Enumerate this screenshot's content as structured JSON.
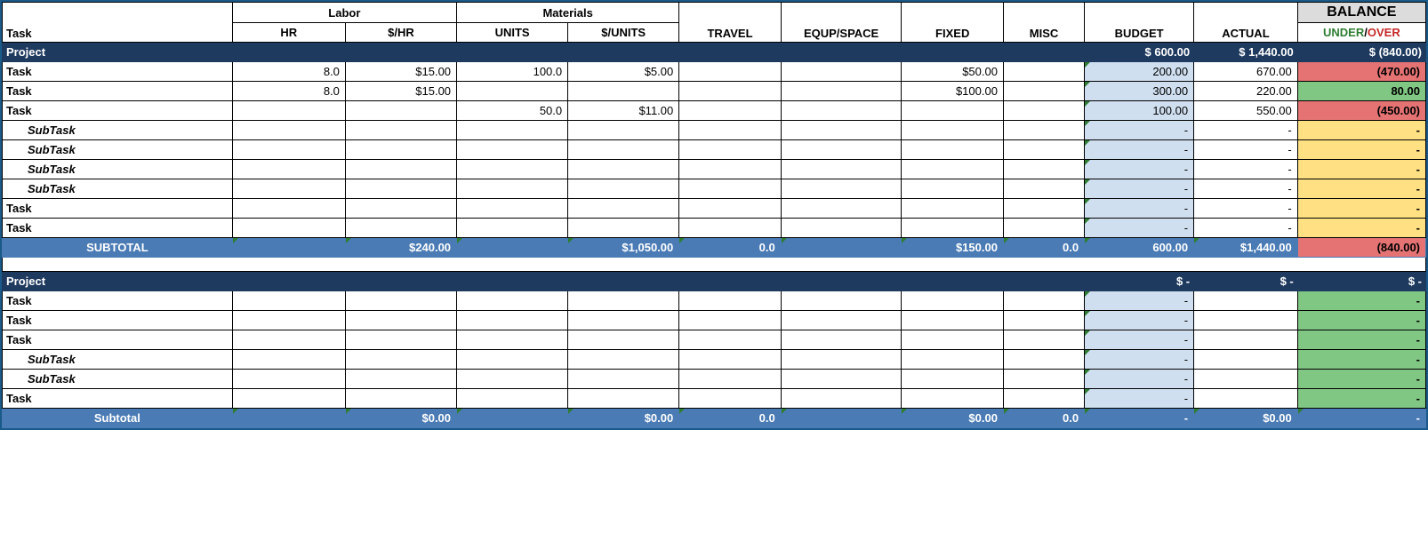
{
  "headers": {
    "labor": "Labor",
    "materials": "Materials",
    "balance": "BALANCE",
    "task": "Task",
    "hr": "HR",
    "rate": "$/HR",
    "units": "UNITS",
    "urate": "$/UNITS",
    "travel": "TRAVEL",
    "equip": "EQUP/SPACE",
    "fixed": "FIXED",
    "misc": "MISC",
    "budget": "BUDGET",
    "actual": "ACTUAL",
    "under": "UNDER",
    "slash": "/",
    "over": "OVER"
  },
  "p1": {
    "label": "Project",
    "budget": "$    600.00",
    "actual": "$ 1,440.00",
    "balance": "$      (840.00)",
    "rows": [
      {
        "label": "Task",
        "type": "task",
        "hr": "8.0",
        "rate": "$15.00",
        "units": "100.0",
        "urate": "$5.00",
        "travel": "",
        "equip": "",
        "fixed": "$50.00",
        "misc": "",
        "budget": "200.00",
        "actual": "670.00",
        "balance": "(470.00)",
        "balclass": "bal-red"
      },
      {
        "label": "Task",
        "type": "task",
        "hr": "8.0",
        "rate": "$15.00",
        "units": "",
        "urate": "",
        "travel": "",
        "equip": "",
        "fixed": "$100.00",
        "misc": "",
        "budget": "300.00",
        "actual": "220.00",
        "balance": "80.00",
        "balclass": "bal-green"
      },
      {
        "label": "Task",
        "type": "task",
        "hr": "",
        "rate": "",
        "units": "50.0",
        "urate": "$11.00",
        "travel": "",
        "equip": "",
        "fixed": "",
        "misc": "",
        "budget": "100.00",
        "actual": "550.00",
        "balance": "(450.00)",
        "balclass": "bal-red"
      },
      {
        "label": "SubTask",
        "type": "sub",
        "hr": "",
        "rate": "",
        "units": "",
        "urate": "",
        "travel": "",
        "equip": "",
        "fixed": "",
        "misc": "",
        "budget": "-",
        "actual": "-",
        "balance": "-",
        "balclass": "bal-yellow"
      },
      {
        "label": "SubTask",
        "type": "sub",
        "hr": "",
        "rate": "",
        "units": "",
        "urate": "",
        "travel": "",
        "equip": "",
        "fixed": "",
        "misc": "",
        "budget": "-",
        "actual": "-",
        "balance": "-",
        "balclass": "bal-yellow"
      },
      {
        "label": "SubTask",
        "type": "sub",
        "hr": "",
        "rate": "",
        "units": "",
        "urate": "",
        "travel": "",
        "equip": "",
        "fixed": "",
        "misc": "",
        "budget": "-",
        "actual": "-",
        "balance": "-",
        "balclass": "bal-yellow"
      },
      {
        "label": "SubTask",
        "type": "sub",
        "hr": "",
        "rate": "",
        "units": "",
        "urate": "",
        "travel": "",
        "equip": "",
        "fixed": "",
        "misc": "",
        "budget": "-",
        "actual": "-",
        "balance": "-",
        "balclass": "bal-yellow"
      },
      {
        "label": "Task",
        "type": "task",
        "hr": "",
        "rate": "",
        "units": "",
        "urate": "",
        "travel": "",
        "equip": "",
        "fixed": "",
        "misc": "",
        "budget": "-",
        "actual": "-",
        "balance": "-",
        "balclass": "bal-yellow"
      },
      {
        "label": "Task",
        "type": "task",
        "hr": "",
        "rate": "",
        "units": "",
        "urate": "",
        "travel": "",
        "equip": "",
        "fixed": "",
        "misc": "",
        "budget": "-",
        "actual": "-",
        "balance": "-",
        "balclass": "bal-yellow"
      }
    ],
    "subtotal": {
      "label": "SUBTOTAL",
      "rate": "$240.00",
      "urate": "$1,050.00",
      "travel": "0.0",
      "fixed": "$150.00",
      "misc": "0.0",
      "budget": "600.00",
      "actual": "$1,440.00",
      "balance": "(840.00)"
    }
  },
  "p2": {
    "label": "Project",
    "budget": "$         -",
    "actual": "$         -",
    "balance": "$              -",
    "rows": [
      {
        "label": "Task",
        "type": "task",
        "hr": "",
        "rate": "",
        "units": "",
        "urate": "",
        "travel": "",
        "equip": "",
        "fixed": "",
        "misc": "",
        "budget": "-",
        "actual": "",
        "balance": "-",
        "balclass": "bal-green"
      },
      {
        "label": "Task",
        "type": "task",
        "hr": "",
        "rate": "",
        "units": "",
        "urate": "",
        "travel": "",
        "equip": "",
        "fixed": "",
        "misc": "",
        "budget": "-",
        "actual": "",
        "balance": "-",
        "balclass": "bal-green"
      },
      {
        "label": "Task",
        "type": "task",
        "hr": "",
        "rate": "",
        "units": "",
        "urate": "",
        "travel": "",
        "equip": "",
        "fixed": "",
        "misc": "",
        "budget": "-",
        "actual": "",
        "balance": "-",
        "balclass": "bal-green"
      },
      {
        "label": "SubTask",
        "type": "sub",
        "hr": "",
        "rate": "",
        "units": "",
        "urate": "",
        "travel": "",
        "equip": "",
        "fixed": "",
        "misc": "",
        "budget": "-",
        "actual": "",
        "balance": "-",
        "balclass": "bal-green"
      },
      {
        "label": "SubTask",
        "type": "sub",
        "hr": "",
        "rate": "",
        "units": "",
        "urate": "",
        "travel": "",
        "equip": "",
        "fixed": "",
        "misc": "",
        "budget": "-",
        "actual": "",
        "balance": "-",
        "balclass": "bal-green"
      },
      {
        "label": "Task",
        "type": "task",
        "hr": "",
        "rate": "",
        "units": "",
        "urate": "",
        "travel": "",
        "equip": "",
        "fixed": "",
        "misc": "",
        "budget": "-",
        "actual": "",
        "balance": "-",
        "balclass": "bal-green"
      }
    ],
    "subtotal": {
      "label": "Subtotal",
      "rate": "$0.00",
      "urate": "$0.00",
      "travel": "0.0",
      "fixed": "$0.00",
      "misc": "0.0",
      "budget": "-",
      "actual": "$0.00",
      "balance": "-"
    }
  }
}
